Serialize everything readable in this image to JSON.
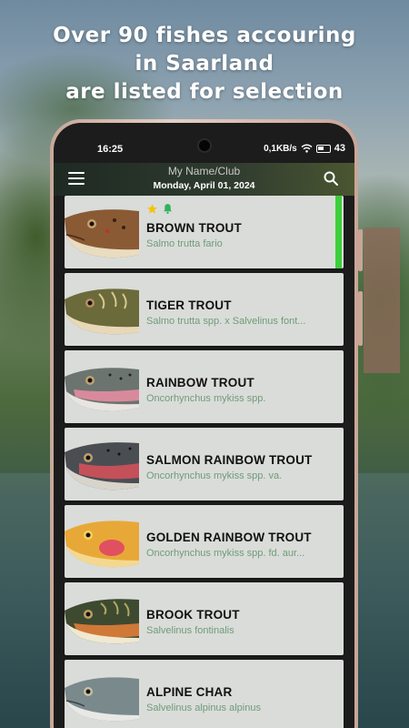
{
  "promo": {
    "headline_line1": "Over 90 fishes accouring",
    "headline_line2": "in Saarland",
    "headline_line3": "are listed for selection"
  },
  "status_bar": {
    "time": "16:25",
    "network_speed": "0,1KB/s",
    "battery": "43"
  },
  "app_bar": {
    "title": "My Name/Club",
    "date": "Monday, April 01, 2024",
    "menu_icon": "hamburger-icon",
    "search_icon": "search-icon"
  },
  "fish_list": [
    {
      "name": "BROWN TROUT",
      "latin": "Salmo trutta fario",
      "selected": true,
      "badges": [
        "star-icon",
        "bell-icon"
      ],
      "accent": "#3ccf3c"
    },
    {
      "name": "TIGER TROUT",
      "latin": "Salmo trutta spp. x Salvelinus font...",
      "selected": false
    },
    {
      "name": "RAINBOW TROUT",
      "latin": "Oncorhynchus mykiss spp.",
      "selected": false
    },
    {
      "name": "SALMON RAINBOW TROUT",
      "latin": "Oncorhynchus mykiss spp. va.",
      "selected": false
    },
    {
      "name": "GOLDEN RAINBOW TROUT",
      "latin": "Oncorhynchus mykiss spp. fd. aur...",
      "selected": false
    },
    {
      "name": "BROOK TROUT",
      "latin": "Salvelinus fontinalis",
      "selected": false
    },
    {
      "name": "ALPINE CHAR",
      "latin": "Salvelinus alpinus alpinus",
      "selected": false
    }
  ],
  "colors": {
    "selected_accent": "#3ccf3c",
    "latin_text": "#6f9c7a",
    "star": "#f2c40c",
    "bell": "#2fb35a"
  }
}
